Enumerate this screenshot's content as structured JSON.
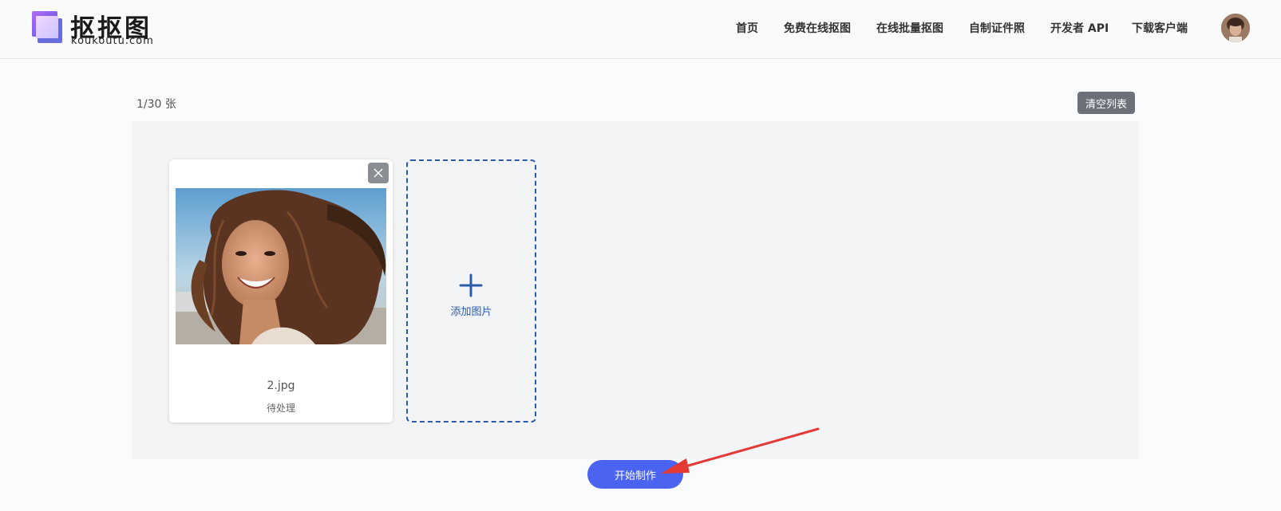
{
  "brand": {
    "name": "抠抠图",
    "domain": "koukoutu.com",
    "accent_colors": [
      "#8b5cf6",
      "#3b82f6",
      "#ec4899"
    ]
  },
  "nav": {
    "items": [
      {
        "label": "首页"
      },
      {
        "label": "免费在线抠图"
      },
      {
        "label": "在线批量抠图"
      },
      {
        "label": "自制证件照"
      },
      {
        "label": "开发者 API"
      },
      {
        "label": "下载客户端"
      }
    ]
  },
  "toolbar": {
    "count": "1/30 张",
    "clear_label": "清空列表"
  },
  "images": [
    {
      "file_name": "2.jpg",
      "status": "待处理",
      "icon": "close-icon"
    }
  ],
  "add_tile": {
    "label": "添加图片",
    "icon": "plus-icon",
    "color": "#2a5caa"
  },
  "actions": {
    "start_label": "开始制作",
    "start_color": "#4a63f0"
  },
  "annotation": {
    "arrow_color": "#e53935"
  }
}
